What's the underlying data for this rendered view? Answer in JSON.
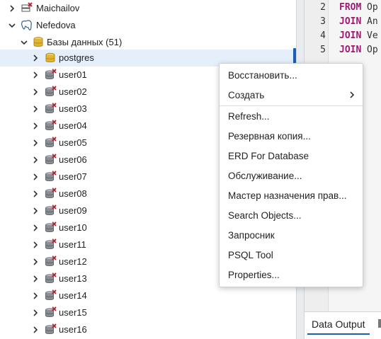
{
  "tree": {
    "servers": [
      {
        "label": "Maichailov",
        "expanded": false
      },
      {
        "label": "Nefedova",
        "expanded": true
      }
    ],
    "databases_group": {
      "label": "Базы данных (51)"
    },
    "databases": [
      {
        "label": "postgres",
        "selected": true,
        "connected": true
      },
      {
        "label": "user01"
      },
      {
        "label": "user02"
      },
      {
        "label": "user03"
      },
      {
        "label": "user04"
      },
      {
        "label": "user05"
      },
      {
        "label": "user06"
      },
      {
        "label": "user07"
      },
      {
        "label": "user08"
      },
      {
        "label": "user09"
      },
      {
        "label": "user10"
      },
      {
        "label": "user11"
      },
      {
        "label": "user12"
      },
      {
        "label": "user13"
      },
      {
        "label": "user14"
      },
      {
        "label": "user15"
      },
      {
        "label": "user16"
      }
    ]
  },
  "editor": {
    "lines": [
      {
        "num": "2",
        "kw": "FROM",
        "text": "Op"
      },
      {
        "num": "3",
        "kw": "JOIN",
        "text": "An"
      },
      {
        "num": "4",
        "kw": "JOIN",
        "text": "Ve"
      },
      {
        "num": "5",
        "kw": "JOIN",
        "text": "Op"
      }
    ]
  },
  "results": {
    "tab_label": "Data Output"
  },
  "context_menu": {
    "items": [
      {
        "label": "Восстановить..."
      },
      {
        "label": "Создать",
        "submenu": true
      },
      {
        "label": "Refresh..."
      },
      {
        "label": "Резервная копия..."
      },
      {
        "label": "ERD For Database"
      },
      {
        "label": "Обслуживание..."
      },
      {
        "label": "Мастер назначения прав..."
      },
      {
        "label": "Search Objects..."
      },
      {
        "label": "Запросник"
      },
      {
        "label": "PSQL Tool"
      },
      {
        "label": "Properties..."
      }
    ]
  },
  "colors": {
    "accent": "#1a5fb4",
    "keyword": "#9b1b73",
    "selection": "#e5eefb",
    "db_gold": "#e0b534",
    "db_grey": "#8a8f96",
    "disconnected_red": "#c0262d"
  }
}
